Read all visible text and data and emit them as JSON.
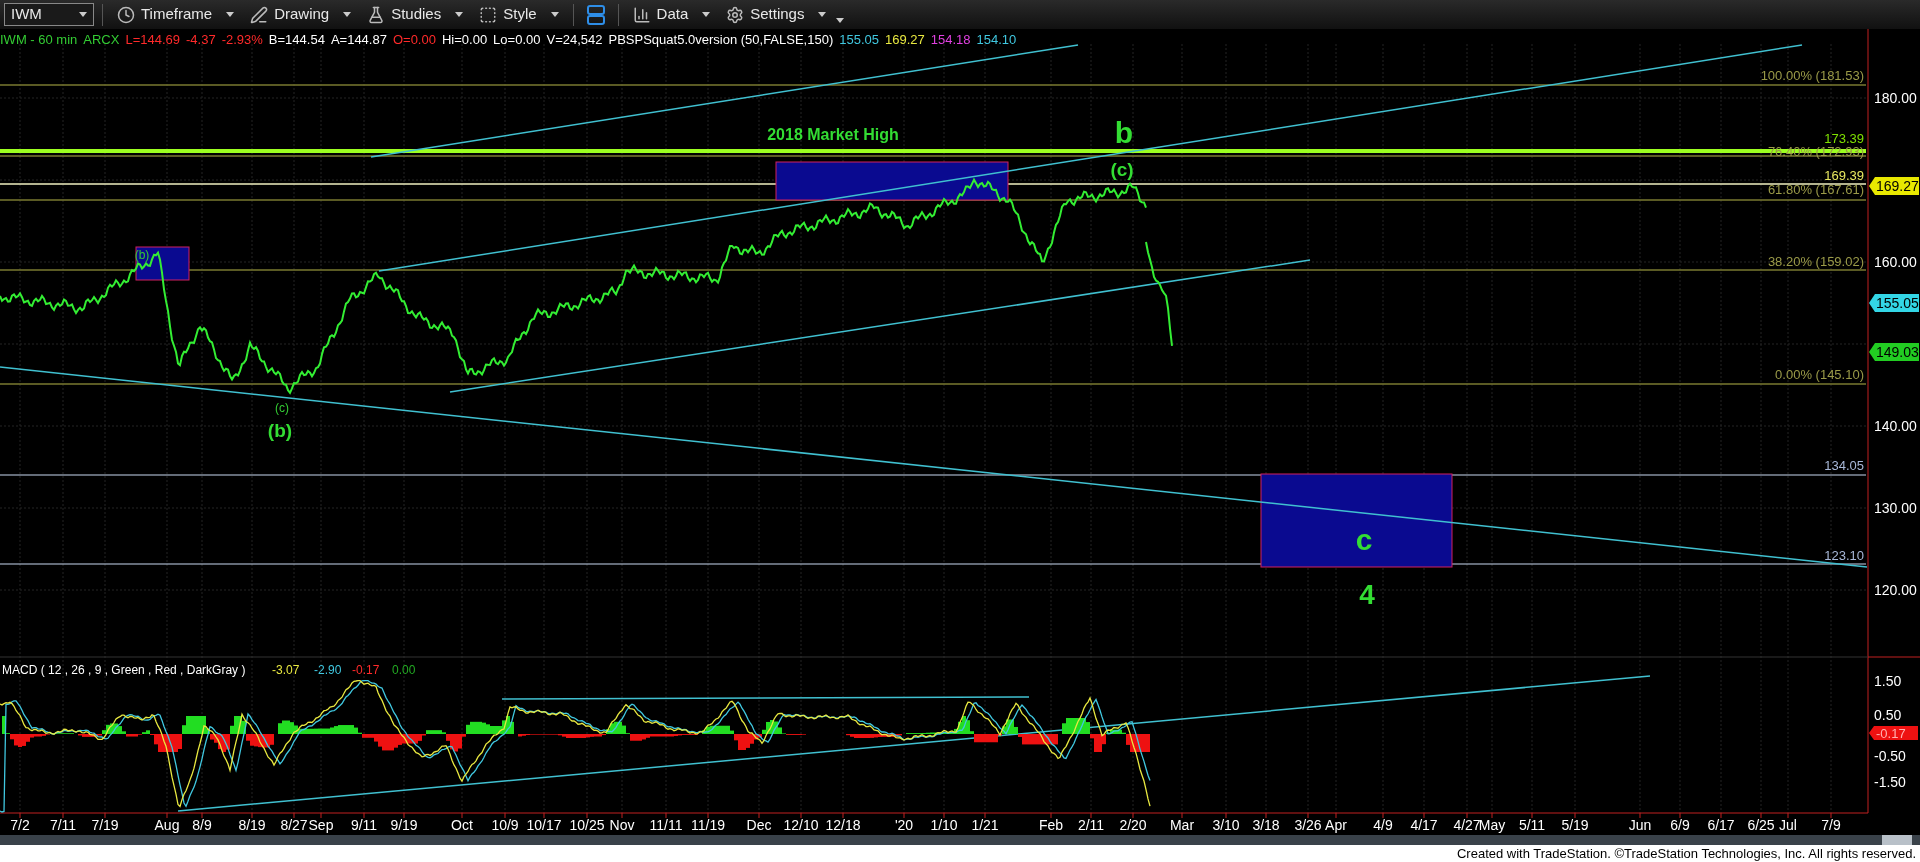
{
  "toolbar": {
    "symbol": "IWM",
    "menus": [
      {
        "kind": "menu",
        "label": "Timeframe"
      },
      {
        "kind": "menu",
        "label": "Drawing"
      },
      {
        "kind": "menu",
        "label": "Studies"
      },
      {
        "kind": "menu",
        "label": "Style"
      },
      {
        "kind": "layout"
      },
      {
        "kind": "menu",
        "label": "Data"
      },
      {
        "kind": "menu",
        "label": "Settings"
      }
    ]
  },
  "info_bar": [
    {
      "text": "IWM - 60 min",
      "color": "#33cc33"
    },
    {
      "text": "ARCX",
      "color": "#33cc33"
    },
    {
      "text": "L=144.69",
      "color": "#ff2a2a"
    },
    {
      "text": "-4.37",
      "color": "#ff2a2a"
    },
    {
      "text": "-2.93%",
      "color": "#ff2a2a"
    },
    {
      "text": "B=144.54",
      "color": "#ffffff"
    },
    {
      "text": "A=144.87",
      "color": "#ffffff"
    },
    {
      "text": "O=0.00",
      "color": "#ff2a2a"
    },
    {
      "text": "Hi=0.00",
      "color": "#ffffff"
    },
    {
      "text": "Lo=0.00",
      "color": "#ffffff"
    },
    {
      "text": "V=24,542",
      "color": "#ffffff"
    },
    {
      "text": "PBSPSquat5.0version (50,FALSE,150)",
      "color": "#ffffff"
    },
    {
      "text": "155.05",
      "color": "#40c8e0"
    },
    {
      "text": "169.27",
      "color": "#e8e840"
    },
    {
      "text": "154.18",
      "color": "#e040e0"
    },
    {
      "text": "154.10",
      "color": "#40c8e0"
    }
  ],
  "price_axis": [
    "180.00",
    "160.00",
    "140.00",
    "130.00",
    "120.00"
  ],
  "price_tags": [
    {
      "text": "169.27",
      "color": "#e8e800"
    },
    {
      "text": "155.05",
      "color": "#33d6e6"
    },
    {
      "text": "149.03",
      "color": "#22cc22"
    }
  ],
  "fib_labels": [
    "100.00% (181.53)",
    "76.40% (172.93)",
    "61.80% (167.61)",
    "38.20% (159.02)",
    "0.00% (145.10)"
  ],
  "level_labels": [
    {
      "text": "173.39",
      "color": "#7fe000"
    },
    {
      "text": "169.39",
      "color": "#e8e860"
    },
    {
      "text": "134.05",
      "color": "#a8b8d8"
    },
    {
      "text": "123.10",
      "color": "#a8b8d8"
    }
  ],
  "annotations": [
    "2018 Market High",
    "b",
    "(c)",
    "(b)",
    "(c)",
    "(b)",
    "c",
    "4"
  ],
  "macd": {
    "title": "MACD ( 12 , 26 , 9 , Green , Red , DarkGray )",
    "values": [
      {
        "text": "-3.07",
        "color": "#e8e840"
      },
      {
        "text": "-2.90",
        "color": "#40c8e0"
      },
      {
        "text": "-0.17",
        "color": "#ff2a2a"
      },
      {
        "text": "0.00",
        "color": "#22aa22"
      }
    ],
    "axis": [
      "1.50",
      "0.50",
      "-0.50",
      "-1.50"
    ],
    "tag": "-0.17"
  },
  "dates": [
    "7/2",
    "7/11",
    "7/19",
    "Aug",
    "8/9",
    "8/19",
    "8/27",
    "Sep",
    "9/11",
    "9/19",
    "Oct",
    "10/9",
    "10/17",
    "10/25",
    "Nov",
    "11/11",
    "11/19",
    "Dec",
    "12/10",
    "12/18",
    "'20",
    "1/10",
    "1/21",
    "Feb",
    "2/11",
    "2/20",
    "Mar",
    "3/10",
    "3/18",
    "3/26",
    "Apr",
    "4/9",
    "4/17",
    "4/27",
    "May",
    "5/11",
    "5/19",
    "Jun",
    "6/9",
    "6/17",
    "6/25",
    "Jul",
    "7/9"
  ],
  "footer": "Created with TradeStation. ©TradeStation Technologies, Inc. All rights reserved."
}
